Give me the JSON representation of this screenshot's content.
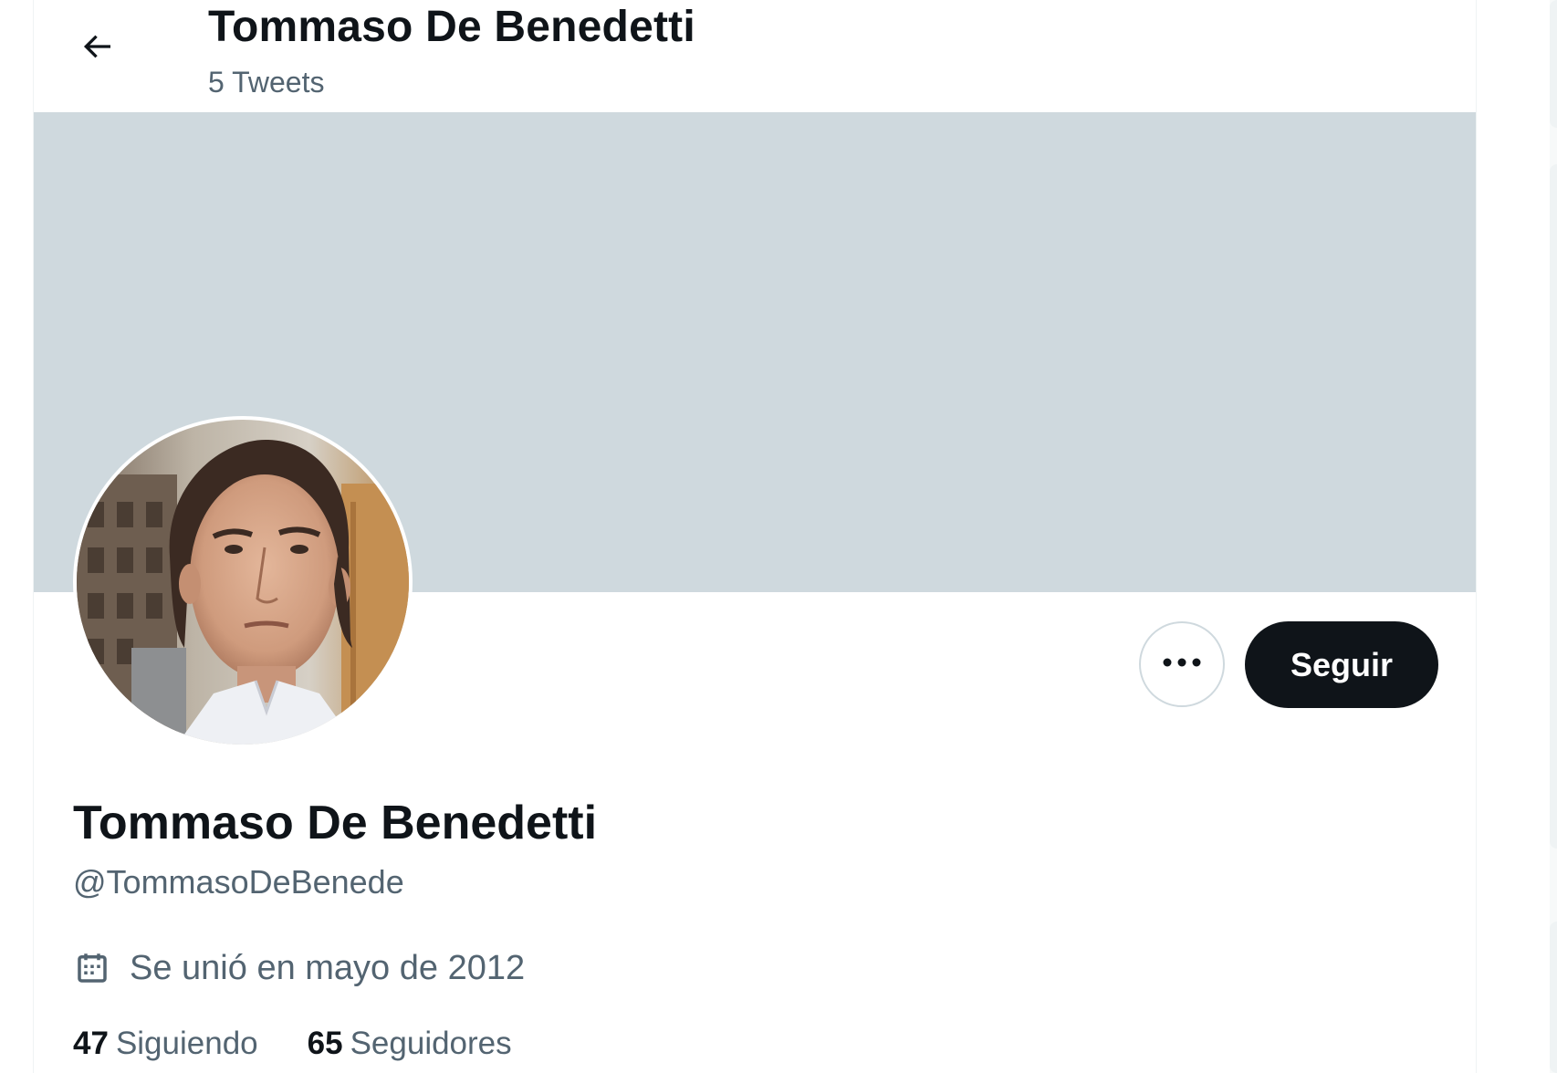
{
  "header": {
    "title": "Tommaso De Benedetti",
    "tweet_count": "5 Tweets"
  },
  "profile": {
    "display_name": "Tommaso De Benedetti",
    "handle": "@TommasoDeBenede",
    "joined": "Se unió en mayo de 2012",
    "following_count": "47",
    "following_label": "Siguiendo",
    "followers_count": "65",
    "followers_label": "Seguidores"
  },
  "actions": {
    "more_label": "•••",
    "follow_label": "Seguir"
  },
  "icons": {
    "back": "arrow-left-icon",
    "calendar": "calendar-icon",
    "more": "more-horizontal-icon"
  },
  "colors": {
    "banner": "#cfd9de",
    "text_primary": "#0f1419",
    "text_secondary": "#536471",
    "follow_button_bg": "#0f1419",
    "border": "#cfd9de"
  }
}
